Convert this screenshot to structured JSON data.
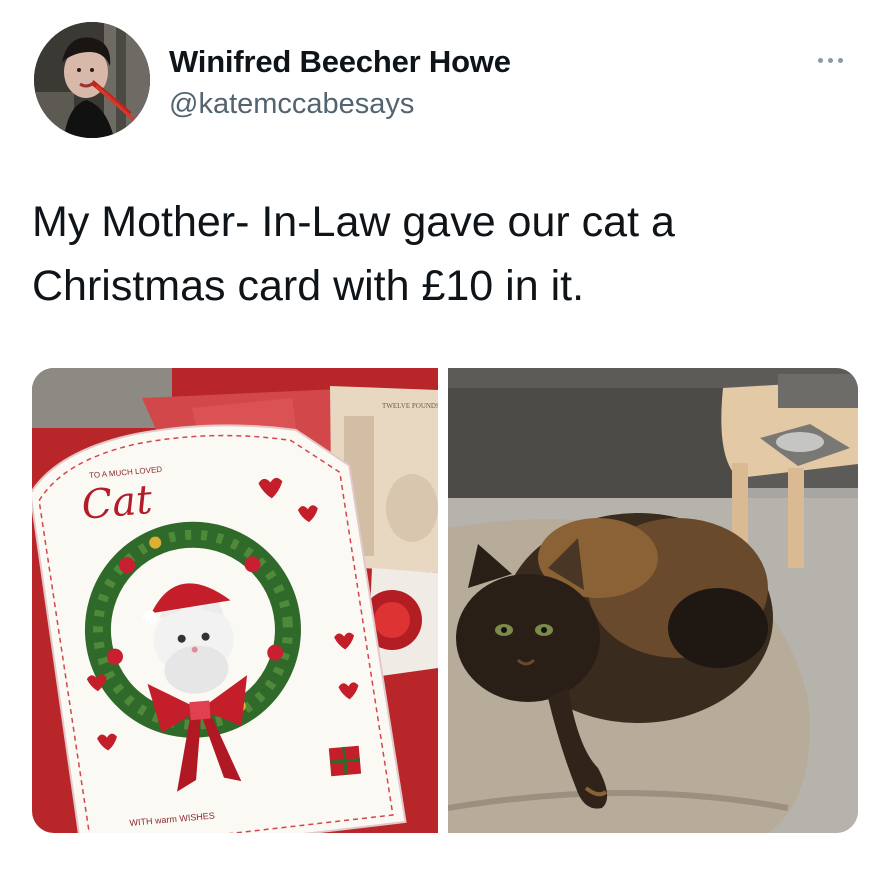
{
  "tweet": {
    "author": {
      "display_name": "Winifred Beecher Howe",
      "handle": "@katemccabesays",
      "avatar_icon": "profile-photo"
    },
    "more_icon": "more-horizontal-icon",
    "text": "My Mother- In-Law gave our cat a Christmas card with £10 in it.",
    "media": [
      {
        "kind": "photo",
        "card": {
          "top_text": "TO A MUCH LOVED",
          "title": "Cat",
          "bottom_text": "WITH warm WISHES"
        },
        "banknote_label": "TWELVE POUNDS"
      },
      {
        "kind": "photo",
        "subject": "tortoiseshell-cat"
      }
    ],
    "colors": {
      "text": "#0f1419",
      "secondary": "#536471",
      "card_red": "#c4202c"
    }
  }
}
